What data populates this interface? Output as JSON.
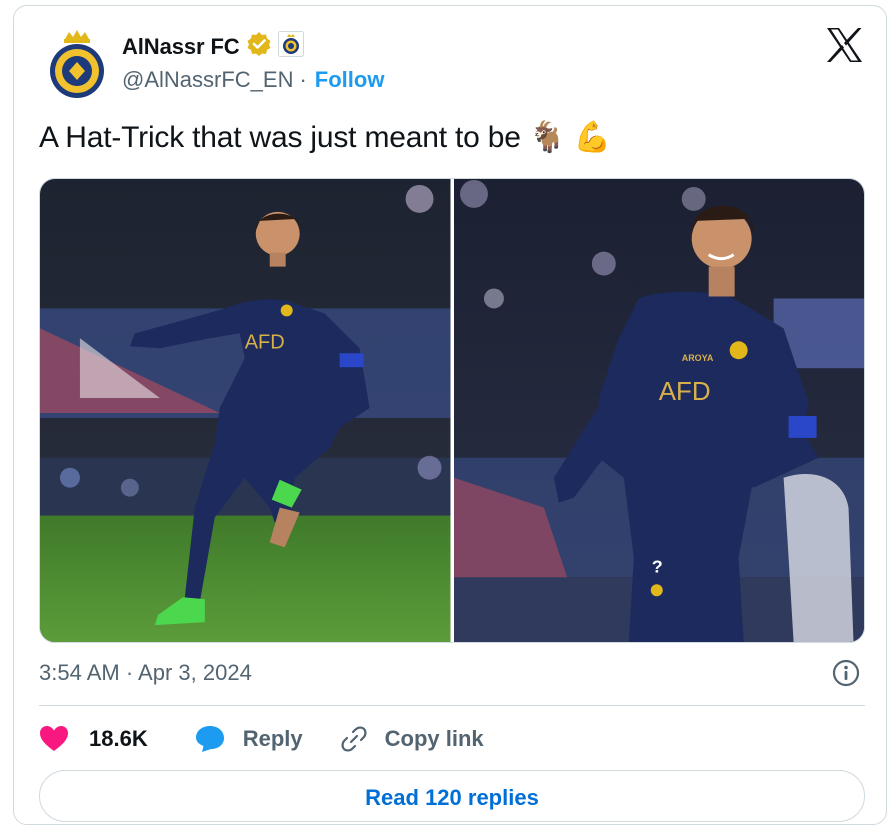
{
  "account": {
    "name": "AlNassr FC",
    "handle": "@AlNassrFC_EN",
    "separator": "·",
    "follow_label": "Follow",
    "verified_icon": "verified-badge-icon",
    "affiliate_icon": "club-crest-icon"
  },
  "platform_icon": "x-logo-icon",
  "tweet": {
    "text": "A Hat-Trick that was just meant to be",
    "emojis": [
      "🐐",
      "💪"
    ],
    "media": [
      {
        "subject": "player celebrating, arm pointing, running on pitch",
        "shirt_text": "AFD"
      },
      {
        "subject": "player smiling close-up celebrating",
        "shirt_text": "AFD",
        "sponsor_text": "AROYA"
      }
    ],
    "timestamp": "3:54 AM · Apr 3, 2024"
  },
  "actions": {
    "like_count": "18.6K",
    "reply_label": "Reply",
    "copy_link_label": "Copy link"
  },
  "read_replies_label": "Read 120 replies",
  "colors": {
    "accent": "#1d9bf0",
    "like": "#f91880",
    "text": "#0f1419",
    "secondary": "#536471",
    "border": "#cfd9de",
    "verified": "#e2b719",
    "kit_navy": "#1d2a5e"
  }
}
